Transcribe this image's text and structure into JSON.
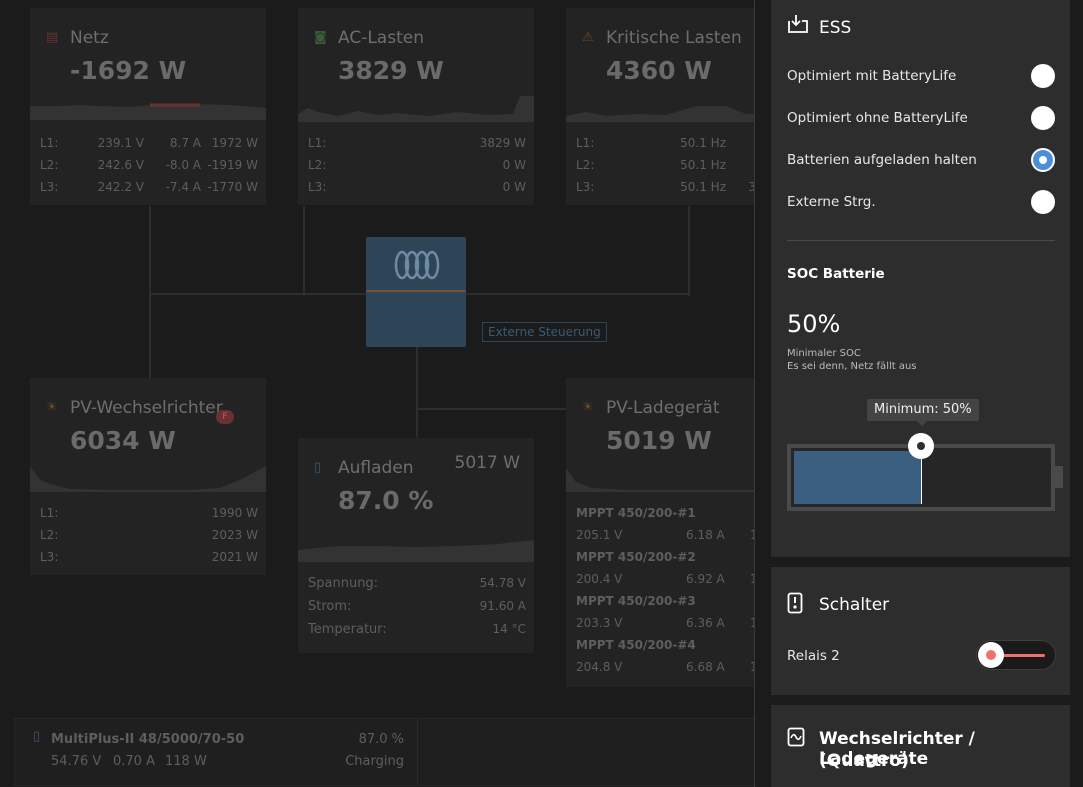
{
  "dashboard": {
    "netz": {
      "title": "Netz",
      "value": "-1692 W",
      "phases": [
        {
          "label": "L1:",
          "v": "239.1 V",
          "a": "8.7 A",
          "w": "1972 W"
        },
        {
          "label": "L2:",
          "v": "242.6 V",
          "a": "-8.0 A",
          "w": "-1919 W"
        },
        {
          "label": "L3:",
          "v": "242.2 V",
          "a": "-7.4 A",
          "w": "-1770 W"
        }
      ]
    },
    "ac_lasten": {
      "title": "AC-Lasten",
      "value": "3829 W",
      "phases": [
        {
          "label": "L1:",
          "w": "3829 W"
        },
        {
          "label": "L2:",
          "w": "0 W"
        },
        {
          "label": "L3:",
          "w": "0 W"
        }
      ]
    },
    "kritische": {
      "title": "Kritische Lasten",
      "value": "4360 W",
      "phases": [
        {
          "label": "L1:",
          "hz": "50.1 Hz"
        },
        {
          "label": "L2:",
          "hz": "50.1 Hz"
        },
        {
          "label": "L3:",
          "hz": "50.1 Hz",
          "extra": "3"
        }
      ]
    },
    "ext_control": "Externe Steuerung",
    "pv_inv": {
      "title": "PV-Wechselrichter",
      "value": "6034 W",
      "phases": [
        {
          "label": "L1:",
          "w": "1990 W"
        },
        {
          "label": "L2:",
          "w": "2023 W"
        },
        {
          "label": "L3:",
          "w": "2021 W"
        }
      ]
    },
    "aufladen": {
      "title": "Aufladen",
      "power": "5017 W",
      "value": "87.0 %",
      "rows": [
        {
          "label": "Spannung:",
          "value": "54.78 V"
        },
        {
          "label": "Strom:",
          "value": "91.60 A"
        },
        {
          "label": "Temperatur:",
          "value": "14 °C"
        }
      ]
    },
    "pv_charger": {
      "title": "PV-Ladegerät",
      "value": "5019 W",
      "mppts": [
        {
          "name": "MPPT 450/200-#1",
          "v": "205.1 V",
          "a": "6.18 A",
          "extra": "1"
        },
        {
          "name": "MPPT 450/200-#2",
          "v": "200.4 V",
          "a": "6.92 A",
          "extra": "1"
        },
        {
          "name": "MPPT 450/200-#3",
          "v": "203.3 V",
          "a": "6.36 A",
          "extra": "1"
        },
        {
          "name": "MPPT 450/200-#4",
          "v": "204.8 V",
          "a": "6.68 A",
          "extra": "1"
        }
      ]
    },
    "multiplus": {
      "name": "MultiPlus-II 48/5000/70-50",
      "soc": "87.0 %",
      "voltage": "54.76 V",
      "current": "0.70 A",
      "power": "118 W",
      "state": "Charging"
    }
  },
  "ess": {
    "title": "ESS",
    "options": [
      {
        "label": "Optimiert mit BatteryLife",
        "selected": false
      },
      {
        "label": "Optimiert ohne BatteryLife",
        "selected": false
      },
      {
        "label": "Batterien aufgeladen halten",
        "selected": true
      },
      {
        "label": "Externe Strg.",
        "selected": false
      }
    ],
    "soc_title": "SOC Batterie",
    "soc_value": "50%",
    "soc_level": 50,
    "min_soc_label": "Minimaler SOC",
    "min_soc_note": "Es sei denn, Netz fällt aus",
    "tooltip": "Minimum: 50%"
  },
  "schalter": {
    "title": "Schalter",
    "relay_label": "Relais 2"
  },
  "wechselrichter": {
    "title_line1": "Wechselrichter / Ladegeräte",
    "title_line2": "(Quattro)"
  },
  "colors": {
    "accent_blue": "#4a90d9",
    "relay_red": "#f07070",
    "battery_fill": "#3a5f80"
  }
}
